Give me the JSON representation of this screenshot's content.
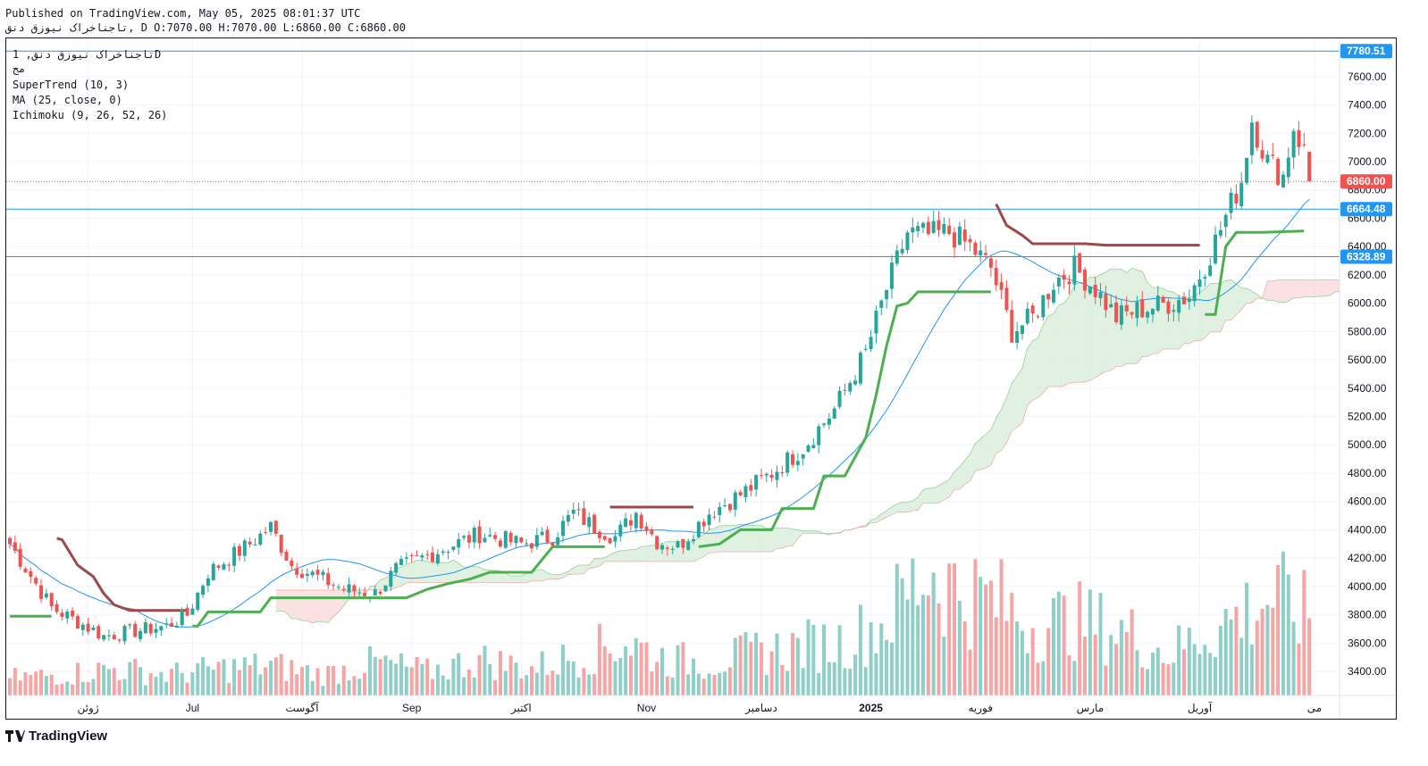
{
  "header": {
    "published_line": "Published on TradingView.com, May 05, 2025 08:01:37 UTC",
    "symbol_line": "تاجناخراک نیوزق دنق, D O:7070.00 H:7070.00 L:6860.00 C:6860.00"
  },
  "legend": {
    "symbol_title": "تاجناخراک نیوزق دنق, 1D",
    "exchange": "مج",
    "indicator_supertrend": "SuperTrend (10, 3)",
    "indicator_ma": "MA (25, close, 0)",
    "indicator_ichimoku": "Ichimoku (9, 26, 52, 26)"
  },
  "footer": {
    "brand": "TradingView"
  },
  "colors": {
    "up": "#26a69a",
    "down": "#ef5350",
    "vol_up": "#8fcfc8",
    "vol_down": "#f5a5a4",
    "supertrend_up": "#4caf50",
    "supertrend_down": "#9c4848",
    "ma": "#2196f3",
    "hline": "#2196f3",
    "cloud_bull": "#d5ecd7",
    "cloud_bear": "#f9d7d7",
    "last_price": "#ef5350"
  },
  "chart_data": {
    "type": "candlestick",
    "y_axis": {
      "ticks": [
        3400,
        3600,
        3800,
        4000,
        4200,
        4400,
        4600,
        4800,
        5000,
        5200,
        5400,
        5600,
        5800,
        6000,
        6200,
        6400,
        6600,
        6800,
        7000,
        7200,
        7400,
        7600
      ],
      "range": [
        3230,
        7870
      ]
    },
    "x_axis": {
      "labels": [
        {
          "text": "ژوئن",
          "bar": 15,
          "bold": false
        },
        {
          "text": "Jul",
          "bar": 35,
          "bold": false
        },
        {
          "text": "آگوست",
          "bar": 56,
          "bold": false
        },
        {
          "text": "Sep",
          "bar": 77,
          "bold": false
        },
        {
          "text": "اکتبر",
          "bar": 98,
          "bold": false
        },
        {
          "text": "Nov",
          "bar": 122,
          "bold": false
        },
        {
          "text": "دسامبر",
          "bar": 144,
          "bold": false
        },
        {
          "text": "2025",
          "bar": 165,
          "bold": true
        },
        {
          "text": "فوریه",
          "bar": 186,
          "bold": false
        },
        {
          "text": "مارس",
          "bar": 207,
          "bold": false
        },
        {
          "text": "آوریل",
          "bar": 228,
          "bold": false
        },
        {
          "text": "می",
          "bar": 250,
          "bold": false
        }
      ]
    },
    "horizontal_lines": [
      {
        "value": 7780.51,
        "label": "7780.51"
      },
      {
        "value": 6664.48,
        "label": "6664.48"
      },
      {
        "value": 6328.89,
        "label": "6328.89"
      }
    ],
    "last_price": {
      "value": 6860.0,
      "label": "6860.00"
    },
    "anchors": [
      [
        0,
        4300
      ],
      [
        8,
        3850
      ],
      [
        18,
        3650
      ],
      [
        30,
        3720
      ],
      [
        34,
        3800
      ],
      [
        38,
        4100
      ],
      [
        46,
        4300
      ],
      [
        50,
        4420
      ],
      [
        54,
        4150
      ],
      [
        64,
        3980
      ],
      [
        70,
        3950
      ],
      [
        74,
        4120
      ],
      [
        82,
        4250
      ],
      [
        90,
        4370
      ],
      [
        98,
        4300
      ],
      [
        104,
        4350
      ],
      [
        108,
        4520
      ],
      [
        112,
        4420
      ],
      [
        116,
        4350
      ],
      [
        120,
        4520
      ],
      [
        124,
        4320
      ],
      [
        128,
        4280
      ],
      [
        134,
        4520
      ],
      [
        140,
        4650
      ],
      [
        146,
        4800
      ],
      [
        152,
        4980
      ],
      [
        158,
        5250
      ],
      [
        164,
        5650
      ],
      [
        168,
        6100
      ],
      [
        172,
        6500
      ],
      [
        176,
        6480
      ],
      [
        180,
        6500
      ],
      [
        184,
        6400
      ],
      [
        188,
        6250
      ],
      [
        192,
        5800
      ],
      [
        196,
        5900
      ],
      [
        200,
        6150
      ],
      [
        204,
        6250
      ],
      [
        208,
        6100
      ],
      [
        212,
        5900
      ],
      [
        216,
        5950
      ],
      [
        222,
        6000
      ],
      [
        226,
        6050
      ],
      [
        230,
        6350
      ],
      [
        234,
        6700
      ],
      [
        236,
        6870
      ],
      [
        238,
        7300
      ],
      [
        241,
        7000
      ],
      [
        244,
        6900
      ],
      [
        246,
        7250
      ],
      [
        248,
        7070
      ],
      [
        249,
        6860
      ]
    ],
    "volume_anchors": [
      [
        0,
        60
      ],
      [
        10,
        70
      ],
      [
        20,
        90
      ],
      [
        30,
        70
      ],
      [
        40,
        90
      ],
      [
        50,
        100
      ],
      [
        60,
        70
      ],
      [
        70,
        110
      ],
      [
        80,
        80
      ],
      [
        90,
        120
      ],
      [
        100,
        90
      ],
      [
        110,
        140
      ],
      [
        118,
        180
      ],
      [
        126,
        120
      ],
      [
        134,
        110
      ],
      [
        142,
        140
      ],
      [
        150,
        160
      ],
      [
        160,
        180
      ],
      [
        168,
        250
      ],
      [
        176,
        430
      ],
      [
        182,
        340
      ],
      [
        188,
        320
      ],
      [
        196,
        240
      ],
      [
        204,
        250
      ],
      [
        214,
        210
      ],
      [
        222,
        140
      ],
      [
        228,
        200
      ],
      [
        236,
        270
      ],
      [
        242,
        330
      ],
      [
        249,
        260
      ]
    ],
    "supertrend": [
      {
        "from": 0,
        "to": 8,
        "side": "up",
        "start": 3790,
        "end": 3790
      },
      {
        "from": 9,
        "to": 34,
        "side": "down",
        "points": [
          [
            9,
            4340
          ],
          [
            10,
            4330
          ],
          [
            13,
            4150
          ],
          [
            16,
            4070
          ],
          [
            18,
            3950
          ],
          [
            20,
            3870
          ],
          [
            23,
            3830
          ],
          [
            34,
            3830
          ]
        ]
      },
      {
        "from": 35,
        "to": 114,
        "side": "up",
        "points": [
          [
            35,
            3720
          ],
          [
            36,
            3720
          ],
          [
            38,
            3820
          ],
          [
            48,
            3820
          ],
          [
            50,
            3920
          ],
          [
            76,
            3920
          ],
          [
            80,
            3980
          ],
          [
            84,
            4020
          ],
          [
            88,
            4050
          ],
          [
            92,
            4100
          ],
          [
            100,
            4100
          ],
          [
            104,
            4280
          ],
          [
            114,
            4280
          ]
        ]
      },
      {
        "from": 115,
        "to": 131,
        "side": "down",
        "points": [
          [
            115,
            4560
          ],
          [
            131,
            4560
          ]
        ]
      },
      {
        "from": 132,
        "to": 188,
        "side": "up",
        "points": [
          [
            132,
            4280
          ],
          [
            136,
            4300
          ],
          [
            140,
            4400
          ],
          [
            146,
            4400
          ],
          [
            148,
            4550
          ],
          [
            154,
            4550
          ],
          [
            156,
            4780
          ],
          [
            160,
            4780
          ],
          [
            164,
            5050
          ],
          [
            166,
            5350
          ],
          [
            168,
            5700
          ],
          [
            170,
            5980
          ],
          [
            172,
            6000
          ],
          [
            174,
            6080
          ],
          [
            188,
            6080
          ]
        ]
      },
      {
        "from": 189,
        "to": 228,
        "side": "down",
        "points": [
          [
            189,
            6700
          ],
          [
            191,
            6550
          ],
          [
            194,
            6480
          ],
          [
            196,
            6420
          ],
          [
            206,
            6420
          ],
          [
            210,
            6410
          ],
          [
            228,
            6410
          ]
        ]
      },
      {
        "from": 229,
        "to": 248,
        "side": "up",
        "points": [
          [
            229,
            5920
          ],
          [
            231,
            5920
          ],
          [
            233,
            6400
          ],
          [
            235,
            6500
          ],
          [
            240,
            6500
          ],
          [
            248,
            6510
          ]
        ]
      }
    ]
  }
}
